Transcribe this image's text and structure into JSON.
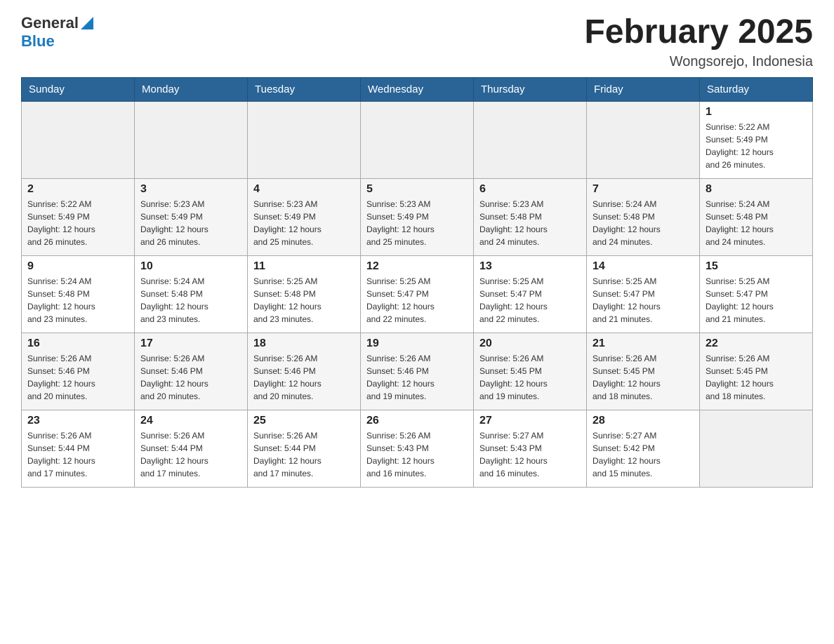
{
  "header": {
    "logo_general": "General",
    "logo_blue": "Blue",
    "month_title": "February 2025",
    "location": "Wongsorejo, Indonesia"
  },
  "days_of_week": [
    "Sunday",
    "Monday",
    "Tuesday",
    "Wednesday",
    "Thursday",
    "Friday",
    "Saturday"
  ],
  "weeks": [
    [
      {
        "day": "",
        "info": ""
      },
      {
        "day": "",
        "info": ""
      },
      {
        "day": "",
        "info": ""
      },
      {
        "day": "",
        "info": ""
      },
      {
        "day": "",
        "info": ""
      },
      {
        "day": "",
        "info": ""
      },
      {
        "day": "1",
        "info": "Sunrise: 5:22 AM\nSunset: 5:49 PM\nDaylight: 12 hours\nand 26 minutes."
      }
    ],
    [
      {
        "day": "2",
        "info": "Sunrise: 5:22 AM\nSunset: 5:49 PM\nDaylight: 12 hours\nand 26 minutes."
      },
      {
        "day": "3",
        "info": "Sunrise: 5:23 AM\nSunset: 5:49 PM\nDaylight: 12 hours\nand 26 minutes."
      },
      {
        "day": "4",
        "info": "Sunrise: 5:23 AM\nSunset: 5:49 PM\nDaylight: 12 hours\nand 25 minutes."
      },
      {
        "day": "5",
        "info": "Sunrise: 5:23 AM\nSunset: 5:49 PM\nDaylight: 12 hours\nand 25 minutes."
      },
      {
        "day": "6",
        "info": "Sunrise: 5:23 AM\nSunset: 5:48 PM\nDaylight: 12 hours\nand 24 minutes."
      },
      {
        "day": "7",
        "info": "Sunrise: 5:24 AM\nSunset: 5:48 PM\nDaylight: 12 hours\nand 24 minutes."
      },
      {
        "day": "8",
        "info": "Sunrise: 5:24 AM\nSunset: 5:48 PM\nDaylight: 12 hours\nand 24 minutes."
      }
    ],
    [
      {
        "day": "9",
        "info": "Sunrise: 5:24 AM\nSunset: 5:48 PM\nDaylight: 12 hours\nand 23 minutes."
      },
      {
        "day": "10",
        "info": "Sunrise: 5:24 AM\nSunset: 5:48 PM\nDaylight: 12 hours\nand 23 minutes."
      },
      {
        "day": "11",
        "info": "Sunrise: 5:25 AM\nSunset: 5:48 PM\nDaylight: 12 hours\nand 23 minutes."
      },
      {
        "day": "12",
        "info": "Sunrise: 5:25 AM\nSunset: 5:47 PM\nDaylight: 12 hours\nand 22 minutes."
      },
      {
        "day": "13",
        "info": "Sunrise: 5:25 AM\nSunset: 5:47 PM\nDaylight: 12 hours\nand 22 minutes."
      },
      {
        "day": "14",
        "info": "Sunrise: 5:25 AM\nSunset: 5:47 PM\nDaylight: 12 hours\nand 21 minutes."
      },
      {
        "day": "15",
        "info": "Sunrise: 5:25 AM\nSunset: 5:47 PM\nDaylight: 12 hours\nand 21 minutes."
      }
    ],
    [
      {
        "day": "16",
        "info": "Sunrise: 5:26 AM\nSunset: 5:46 PM\nDaylight: 12 hours\nand 20 minutes."
      },
      {
        "day": "17",
        "info": "Sunrise: 5:26 AM\nSunset: 5:46 PM\nDaylight: 12 hours\nand 20 minutes."
      },
      {
        "day": "18",
        "info": "Sunrise: 5:26 AM\nSunset: 5:46 PM\nDaylight: 12 hours\nand 20 minutes."
      },
      {
        "day": "19",
        "info": "Sunrise: 5:26 AM\nSunset: 5:46 PM\nDaylight: 12 hours\nand 19 minutes."
      },
      {
        "day": "20",
        "info": "Sunrise: 5:26 AM\nSunset: 5:45 PM\nDaylight: 12 hours\nand 19 minutes."
      },
      {
        "day": "21",
        "info": "Sunrise: 5:26 AM\nSunset: 5:45 PM\nDaylight: 12 hours\nand 18 minutes."
      },
      {
        "day": "22",
        "info": "Sunrise: 5:26 AM\nSunset: 5:45 PM\nDaylight: 12 hours\nand 18 minutes."
      }
    ],
    [
      {
        "day": "23",
        "info": "Sunrise: 5:26 AM\nSunset: 5:44 PM\nDaylight: 12 hours\nand 17 minutes."
      },
      {
        "day": "24",
        "info": "Sunrise: 5:26 AM\nSunset: 5:44 PM\nDaylight: 12 hours\nand 17 minutes."
      },
      {
        "day": "25",
        "info": "Sunrise: 5:26 AM\nSunset: 5:44 PM\nDaylight: 12 hours\nand 17 minutes."
      },
      {
        "day": "26",
        "info": "Sunrise: 5:26 AM\nSunset: 5:43 PM\nDaylight: 12 hours\nand 16 minutes."
      },
      {
        "day": "27",
        "info": "Sunrise: 5:27 AM\nSunset: 5:43 PM\nDaylight: 12 hours\nand 16 minutes."
      },
      {
        "day": "28",
        "info": "Sunrise: 5:27 AM\nSunset: 5:42 PM\nDaylight: 12 hours\nand 15 minutes."
      },
      {
        "day": "",
        "info": ""
      }
    ]
  ]
}
